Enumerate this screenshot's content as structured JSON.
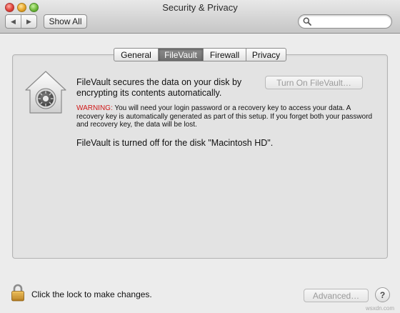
{
  "window": {
    "title": "Security & Privacy"
  },
  "toolbar": {
    "back_icon": "back-arrow-icon",
    "forward_icon": "forward-arrow-icon",
    "back_glyph": "◀",
    "forward_glyph": "▶",
    "show_all_label": "Show All",
    "search": {
      "icon": "magnifier-icon",
      "value": "",
      "placeholder": ""
    }
  },
  "tabs": [
    {
      "label": "General",
      "active": false
    },
    {
      "label": "FileVault",
      "active": true
    },
    {
      "label": "Firewall",
      "active": false
    },
    {
      "label": "Privacy",
      "active": false
    }
  ],
  "filevault": {
    "icon": "filevault-house-icon",
    "description": "FileVault secures the data on your disk by encrypting its contents automatically.",
    "turn_on_button": "Turn On FileVault…",
    "warning_label": "WARNING:",
    "warning_text": "You will need your login password or a recovery key to access your data. A recovery key is automatically generated as part of this setup. If you forget both your password and recovery key, the data will be lost.",
    "status": "FileVault is turned off for the disk \"Macintosh HD\"."
  },
  "footer": {
    "lock_icon": "padlock-icon",
    "lock_text": "Click the lock to make changes.",
    "advanced_button": "Advanced…",
    "help_glyph": "?"
  },
  "watermark": "wsxdn.com",
  "colors": {
    "warning": "#d01818",
    "active_tab": "#7d7d7d",
    "disabled_text": "#9a9a9a"
  }
}
